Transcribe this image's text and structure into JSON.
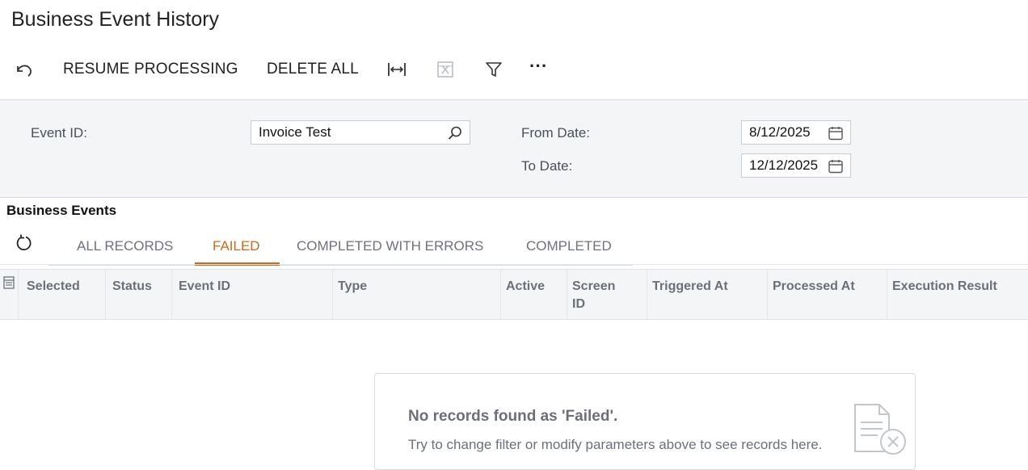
{
  "page": {
    "title": "Business Event History"
  },
  "toolbar": {
    "undo_icon": "undo-icon",
    "resume_label": "RESUME PROCESSING",
    "delete_all_label": "DELETE ALL",
    "fit_icon": "fit-columns-icon",
    "excel_icon": "excel-export-icon",
    "filter_icon": "filter-icon",
    "more_label": "···"
  },
  "filters": {
    "event_id_label": "Event ID:",
    "event_id_value": "Invoice Test",
    "from_date_label": "From Date:",
    "from_date_value": "8/12/2025",
    "to_date_label": "To Date:",
    "to_date_value": "12/12/2025"
  },
  "grid": {
    "title": "Business Events",
    "tabs": [
      {
        "label": "ALL RECORDS"
      },
      {
        "label": "FAILED",
        "active": true
      },
      {
        "label": "COMPLETED WITH ERRORS"
      },
      {
        "label": "COMPLETED"
      }
    ],
    "columns": [
      {
        "label": "Selected"
      },
      {
        "label": "Status"
      },
      {
        "label": "Event ID"
      },
      {
        "label": "Type"
      },
      {
        "label": "Active"
      },
      {
        "label": "Screen ID"
      },
      {
        "label": "Triggered At"
      },
      {
        "label": "Processed At"
      },
      {
        "label": "Execution Result"
      }
    ],
    "rows": [],
    "empty": {
      "title": "No records found as 'Failed'.",
      "subtitle": "Try to change filter or modify parameters above to see records here."
    }
  },
  "colors": {
    "accent": "#c96b1c",
    "panel": "#f4f5f7",
    "muted_text": "#6b7078"
  }
}
